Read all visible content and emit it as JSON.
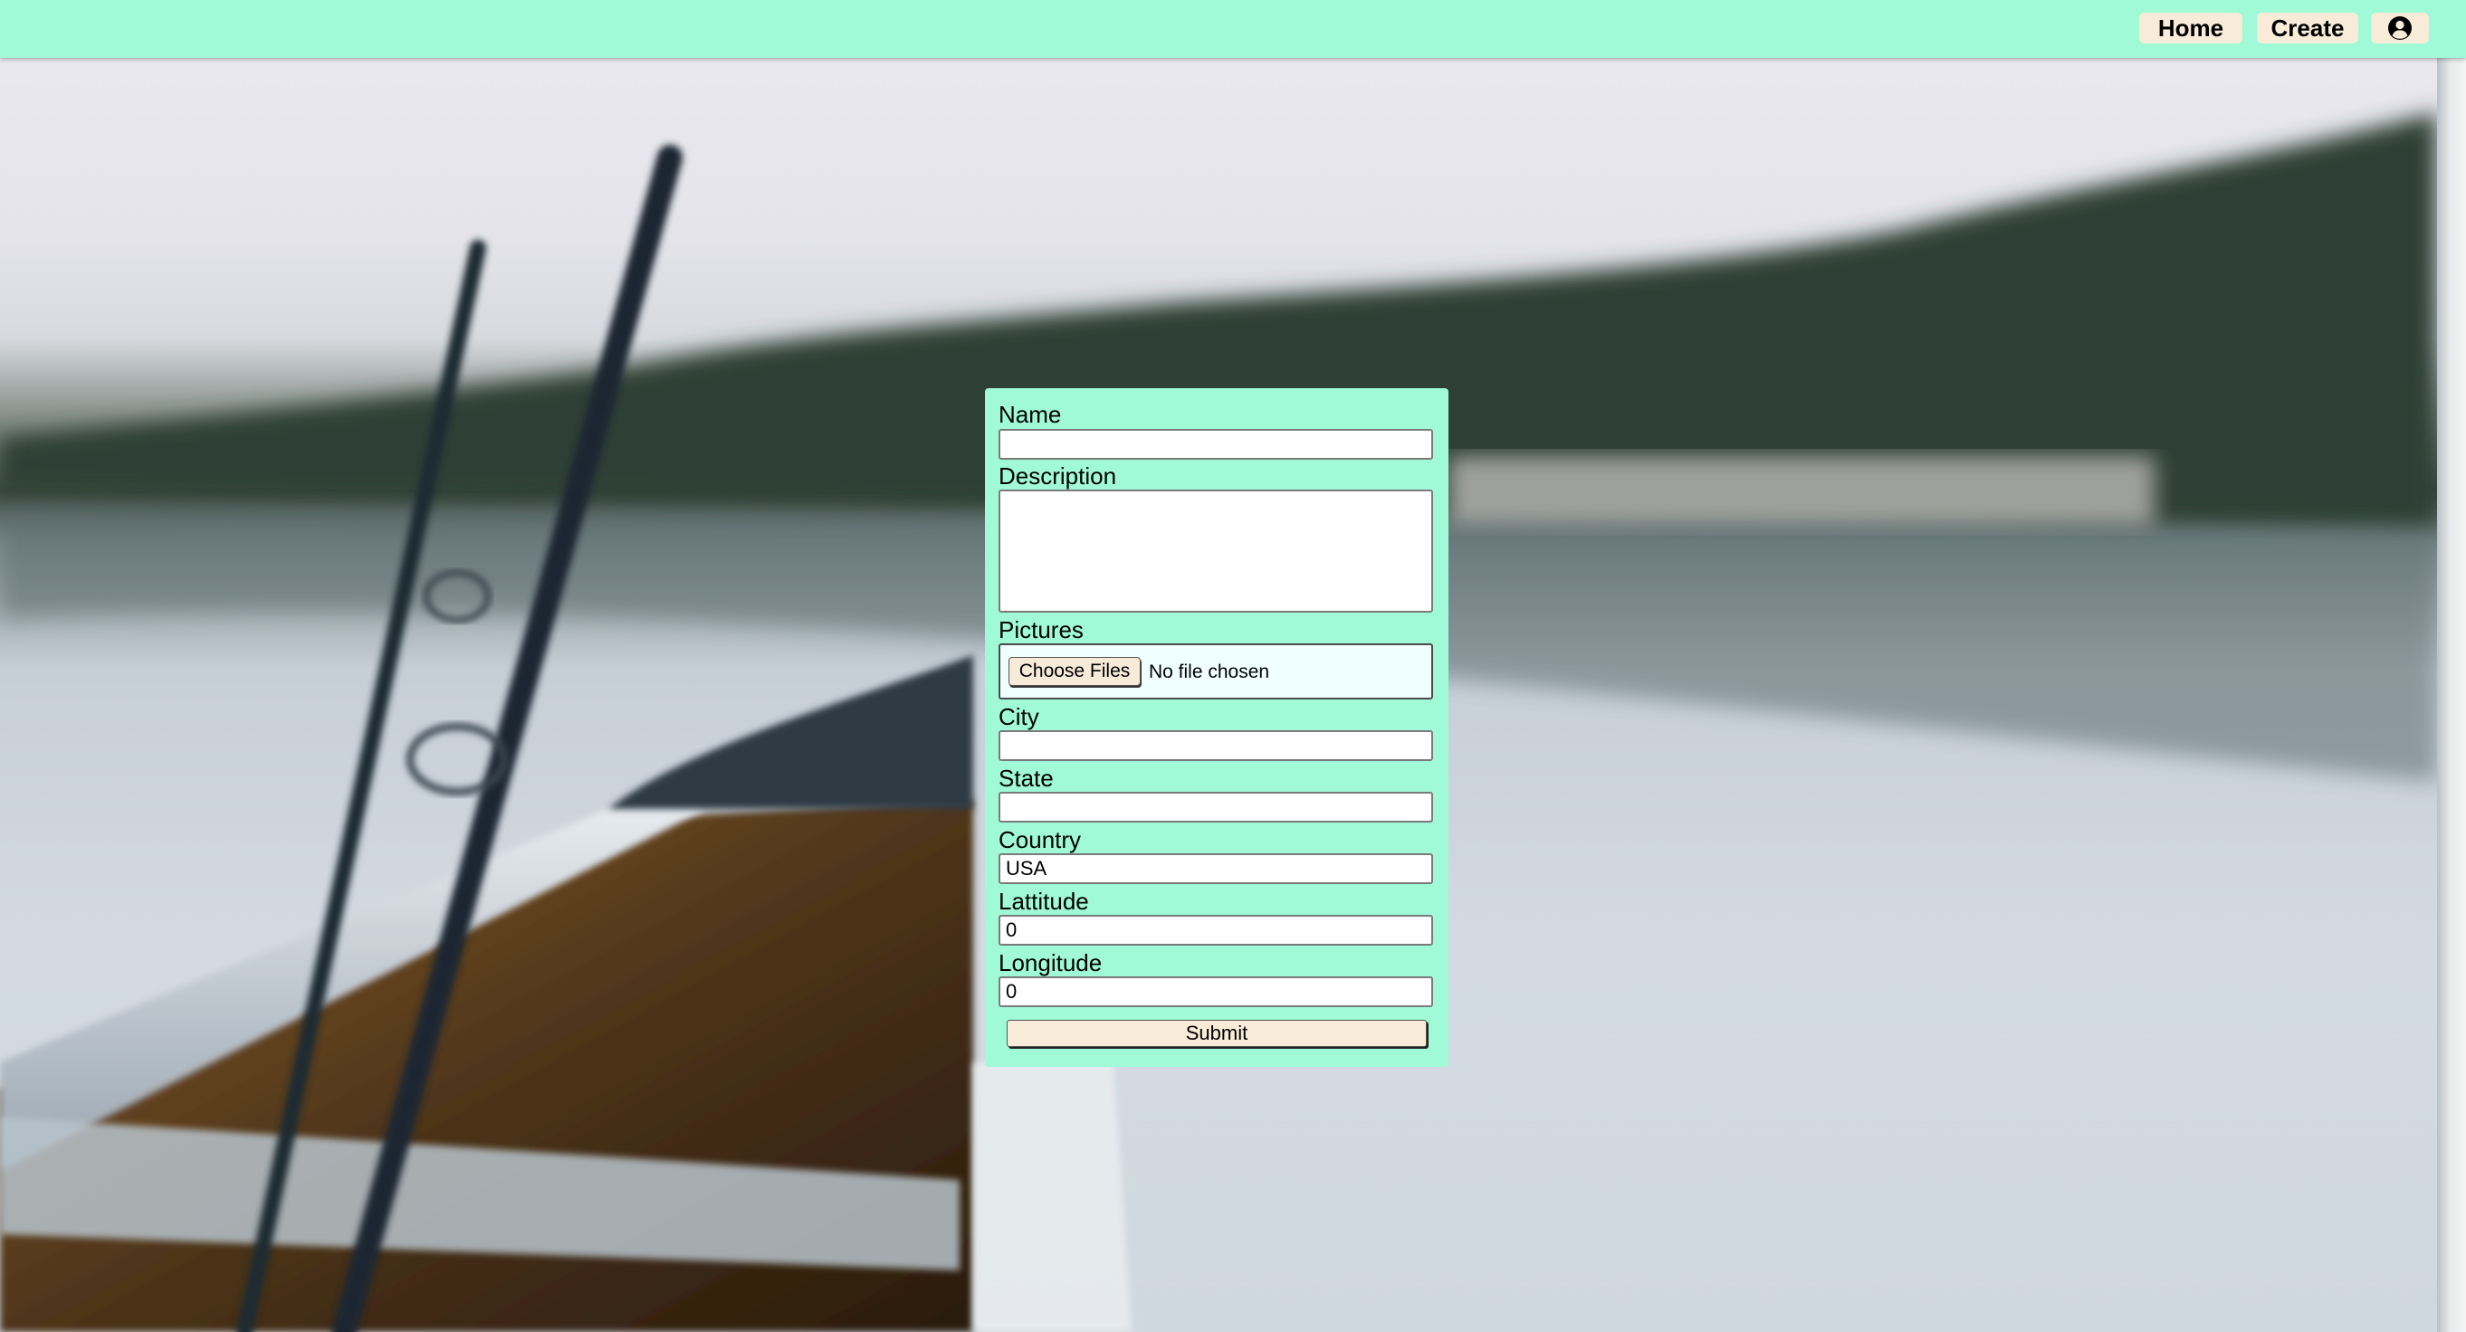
{
  "nav": {
    "home_label": "Home",
    "create_label": "Create",
    "profile_icon": "user-circle-icon"
  },
  "form": {
    "name_label": "Name",
    "name_value": "",
    "description_label": "Description",
    "description_value": "",
    "pictures_label": "Pictures",
    "choose_files_label": "Choose Files",
    "no_file_text": "No file chosen",
    "city_label": "City",
    "city_value": "",
    "state_label": "State",
    "state_value": "",
    "country_label": "Country",
    "country_value": "USA",
    "latitude_label": "Lattitude",
    "latitude_value": "0",
    "longitude_label": "Longitude",
    "longitude_value": "0",
    "submit_label": "Submit"
  },
  "colors": {
    "accent": "#a0fad8",
    "button_bg": "#f8ecd9"
  }
}
